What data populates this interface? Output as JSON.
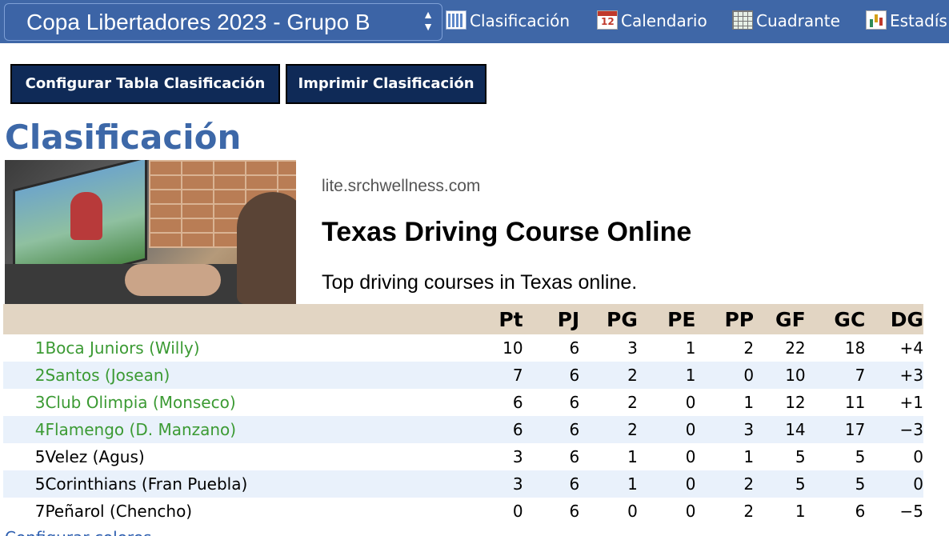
{
  "header": {
    "league_select": "Copa Libertadores 2023 - Grupo B",
    "nav": [
      {
        "label": "Clasificación",
        "icon": "calendar-grid-icon"
      },
      {
        "label": "Calendario",
        "icon": "calendar-icon"
      },
      {
        "label": "Cuadrante",
        "icon": "grid-icon"
      },
      {
        "label": "Estadís",
        "icon": "bar-chart-icon"
      }
    ]
  },
  "buttons": {
    "configure": "Configurar Tabla Clasificación",
    "print": "Imprimir Clasificación"
  },
  "page_title": "Clasificación",
  "ad": {
    "domain": "lite.srchwellness.com",
    "title": "Texas Driving Course Online",
    "description": "Top driving courses in Texas online."
  },
  "table": {
    "columns": [
      "Pt",
      "PJ",
      "PG",
      "PE",
      "PP",
      "GF",
      "GC",
      "DG"
    ],
    "rows": [
      {
        "pos": "1",
        "team": "Boca Juniors (Willy)",
        "promo": true,
        "pt": "10",
        "pj": "6",
        "pg": "3",
        "pe": "1",
        "pp": "2",
        "gf": "22",
        "gc": "18",
        "dg": "+4"
      },
      {
        "pos": "2",
        "team": "Santos (Josean)",
        "promo": true,
        "pt": "7",
        "pj": "6",
        "pg": "2",
        "pe": "1",
        "pp": "0",
        "gf": "10",
        "gc": "7",
        "dg": "+3"
      },
      {
        "pos": "3",
        "team": "Club Olimpia (Monseco)",
        "promo": true,
        "pt": "6",
        "pj": "6",
        "pg": "2",
        "pe": "0",
        "pp": "1",
        "gf": "12",
        "gc": "11",
        "dg": "+1"
      },
      {
        "pos": "4",
        "team": "Flamengo (D. Manzano)",
        "promo": true,
        "pt": "6",
        "pj": "6",
        "pg": "2",
        "pe": "0",
        "pp": "3",
        "gf": "14",
        "gc": "17",
        "dg": "−3"
      },
      {
        "pos": "5",
        "team": "Velez (Agus)",
        "promo": false,
        "pt": "3",
        "pj": "6",
        "pg": "1",
        "pe": "0",
        "pp": "1",
        "gf": "5",
        "gc": "5",
        "dg": "0"
      },
      {
        "pos": "5",
        "team": "Corinthians (Fran Puebla)",
        "promo": false,
        "pt": "3",
        "pj": "6",
        "pg": "1",
        "pe": "0",
        "pp": "2",
        "gf": "5",
        "gc": "5",
        "dg": "0"
      },
      {
        "pos": "7",
        "team": "Peñarol (Chencho)",
        "promo": false,
        "pt": "0",
        "pj": "6",
        "pg": "0",
        "pe": "0",
        "pp": "2",
        "gf": "1",
        "gc": "6",
        "dg": "−5"
      }
    ]
  },
  "footer": {
    "link": "Configurar colores"
  },
  "colors": {
    "topbar": "#3f67a7",
    "button": "#0f2a57",
    "title": "#3d68a8",
    "promo_team": "#3b9a33",
    "header_row": "#e2d5c3",
    "stripe_row": "#e9f1fb"
  }
}
